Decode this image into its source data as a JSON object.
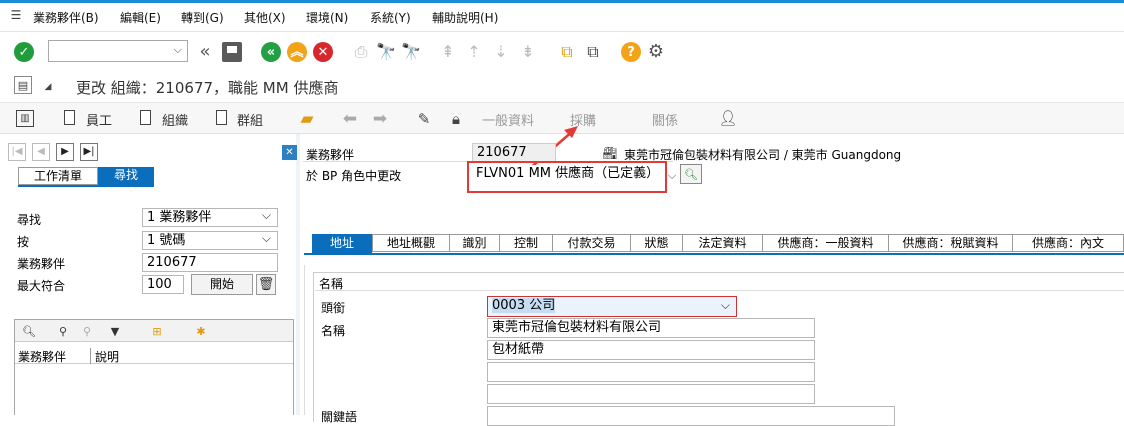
{
  "menu": [
    "業務夥伴(B)",
    "編輯(E)",
    "轉到(G)",
    "其他(X)",
    "環境(N)",
    "系統(Y)",
    "輔助說明(H)"
  ],
  "page_title": "更改 組織：210677，職能 MM 供應商",
  "toolbar2": {
    "employee": "員工",
    "organization": "組織",
    "group": "群組",
    "general_data": "一般資料",
    "purchasing": "採購",
    "relationships": "關係"
  },
  "left": {
    "tab_worklist": "工作清單",
    "tab_find": "尋找",
    "find_label": "尋找",
    "find_value": "1 業務夥伴",
    "by_label": "按",
    "by_value": "1 號碼",
    "bp_label": "業務夥伴",
    "bp_value": "210677",
    "max_label": "最大符合",
    "max_value": "100",
    "start_button": "開始",
    "col_bp": "業務夥伴",
    "col_desc": "說明"
  },
  "header": {
    "bp_label": "業務夥伴",
    "bp_value": "210677",
    "bp_desc": "東莞市冠倫包裝材料有限公司 / 東莞市 Guangdong",
    "role_label": "於 BP 角色中更改",
    "role_value": "FLVN01 MM 供應商（已定義）"
  },
  "tabs": [
    "地址",
    "地址概觀",
    "識別",
    "控制",
    "付款交易",
    "狀態",
    "法定資料",
    "供應商：一般資料",
    "供應商：稅賦資料",
    "供應商：內文"
  ],
  "section": {
    "title": "名稱",
    "title_label": "頭銜",
    "title_value": "0003 公司",
    "name_label": "名稱",
    "name1": "東莞市冠倫包裝材料有限公司",
    "name2": "包材紙帶",
    "name3": "",
    "name4": "",
    "partial_label": "關鍵語"
  },
  "colors": {
    "accent": "#1a8dd6",
    "highlight": "#e53935",
    "tab_active": "#0a6ebd"
  }
}
